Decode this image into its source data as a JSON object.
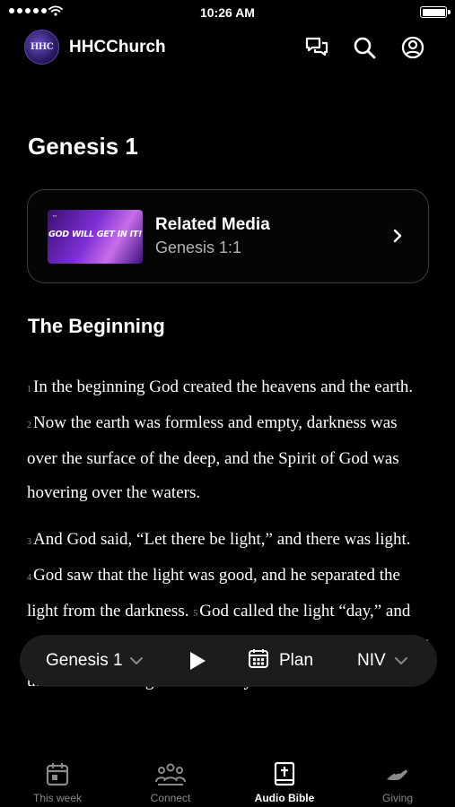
{
  "status_bar": {
    "time": "10:26 AM"
  },
  "header": {
    "logo_text": "HHC",
    "app_name": "HHCChurch"
  },
  "page": {
    "title": "Genesis 1"
  },
  "related_media": {
    "title": "Related Media",
    "subtitle": "Genesis 1:1",
    "thumbnail_text": "GOD WILL GET IN IT!"
  },
  "section": {
    "heading": "The Beginning"
  },
  "scripture": [
    {
      "verses": [
        {
          "num": "1",
          "text": "In the beginning God created the heavens and the earth."
        },
        {
          "num": "2",
          "text": "Now the earth was formless and empty, darkness was over the surface of the deep, and the Spirit of God was hovering over the waters."
        }
      ]
    },
    {
      "verses": [
        {
          "num": "3",
          "text": "And God said, “Let there be light,” and there was light."
        },
        {
          "num": "4",
          "text": "God saw that the light was good, and he separated the light from the darkness."
        },
        {
          "num": "5",
          "text": "God called the light “day,” and the darkness he called “night.” And there was evening, and there was morning—the first day."
        }
      ]
    }
  ],
  "player": {
    "chapter": "Genesis 1",
    "plan_label": "Plan",
    "version": "NIV"
  },
  "tabs": [
    {
      "label": "This week",
      "icon": "calendar-icon",
      "active": false
    },
    {
      "label": "Connect",
      "icon": "people-icon",
      "active": false
    },
    {
      "label": "Audio Bible",
      "icon": "bible-icon",
      "active": true
    },
    {
      "label": "Giving",
      "icon": "giving-hand-icon",
      "active": false
    }
  ],
  "colors": {
    "background": "#000000",
    "player_bg": "#1c1c1e",
    "inactive_tab": "#8a8a8a",
    "card_border": "#3c3c3c"
  }
}
